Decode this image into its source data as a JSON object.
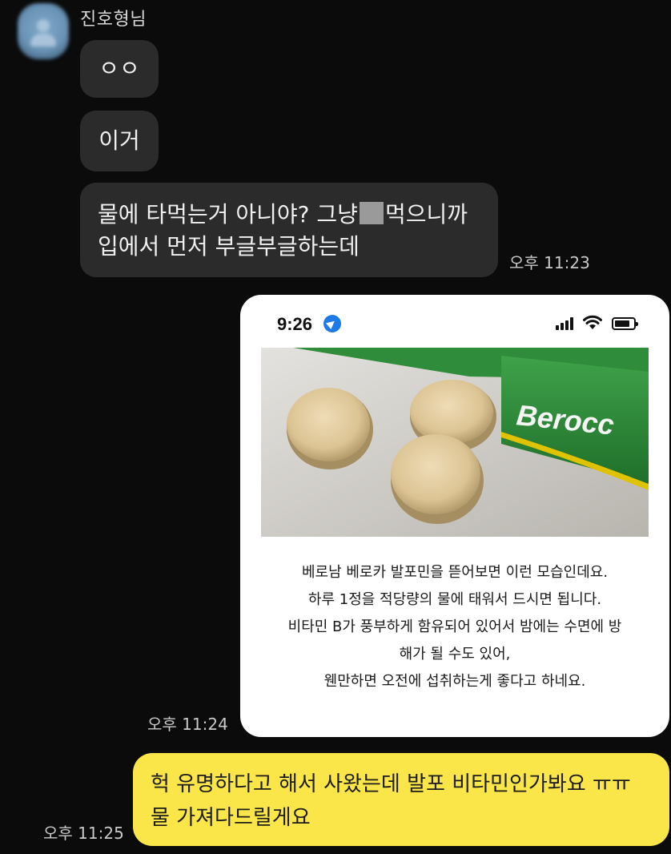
{
  "chat": {
    "sender_name": "진호형님",
    "avatar_icon": "profile-avatar-icon",
    "incoming": [
      {
        "text": "ㅇㅇ"
      },
      {
        "text": "이거"
      },
      {
        "line1_a": "물에 타먹는거 아니야? 그냥",
        "line1_b": "먹으니까",
        "line2": "입에서 먼저 부글부글하는데"
      }
    ],
    "timestamps": [
      "오후 11:23",
      "오후 11:24",
      "오후 11:25"
    ],
    "shared_card": {
      "status_time": "9:26",
      "photo_brand_text": "Berocc",
      "caption_lines": [
        "베로남 베로카 발포민을 뜯어보면 이런 모습인데요.",
        "하루 1정을 적당량의 물에 태워서 드시면 됩니다.",
        "비타민 B가 풍부하게 함유되어 있어서 밤에는 수면에 방",
        "해가 될 수도 있어,",
        "웬만하면  오전에 섭취하는게 좋다고 하네요."
      ]
    },
    "outgoing": {
      "line1": "헉 유명하다고 해서 사왔는데 발포 비타민인가봐요 ㅠㅠ",
      "line2": "물 가져다드릴게요"
    }
  },
  "colors": {
    "background": "#0b0b0b",
    "incoming_bubble": "#2b2b2b",
    "outgoing_bubble": "#fbe64a",
    "card": "#ffffff",
    "location_blue": "#1e7ae6"
  }
}
